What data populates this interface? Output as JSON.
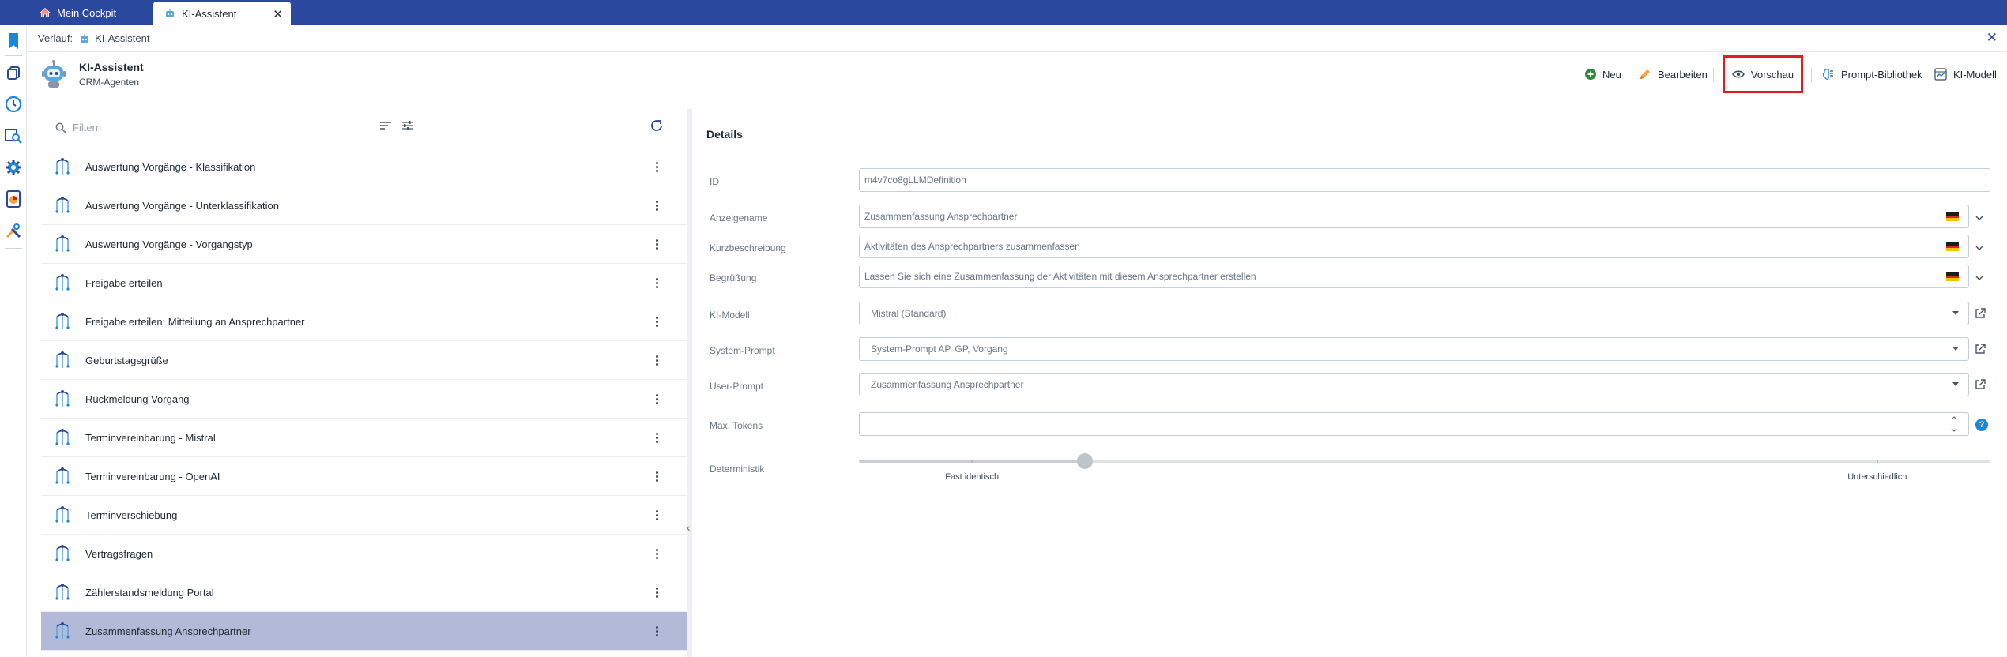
{
  "tabs": [
    {
      "label": "Mein Cockpit",
      "icon": "home-icon"
    },
    {
      "label": "KI-Assistent",
      "icon": "robot-icon"
    }
  ],
  "rail_icons": [
    "bookmark-icon",
    "copy-icon",
    "history-icon",
    "search-list-icon",
    "settings-gear-icon",
    "report-icon",
    "tools-icon"
  ],
  "breadcrumb": {
    "label": "Verlauf:",
    "item": "KI-Assistent"
  },
  "header": {
    "title": "KI-Assistent",
    "subtitle": "CRM-Agenten"
  },
  "toolbar": {
    "neu": "Neu",
    "bearbeiten": "Bearbeiten",
    "vorschau": "Vorschau",
    "prompt_bibliothek": "Prompt-Bibliothek",
    "ki_modell": "KI-Modell"
  },
  "filter": {
    "placeholder": "Filtern"
  },
  "agents": [
    {
      "label": "Auswertung Vorgänge - Klassifikation"
    },
    {
      "label": "Auswertung Vorgänge - Unterklassifikation"
    },
    {
      "label": "Auswertung Vorgänge - Vorgangstyp"
    },
    {
      "label": "Freigabe erteilen"
    },
    {
      "label": "Freigabe erteilen: Mitteilung an Ansprechpartner"
    },
    {
      "label": "Geburtstagsgrüße"
    },
    {
      "label": "Rückmeldung Vorgang"
    },
    {
      "label": "Terminvereinbarung - Mistral"
    },
    {
      "label": "Terminvereinbarung - OpenAI"
    },
    {
      "label": "Terminverschiebung"
    },
    {
      "label": "Vertragsfragen"
    },
    {
      "label": "Zählerstandsmeldung Portal"
    },
    {
      "label": "Zusammenfassung Ansprechpartner",
      "selected": true
    }
  ],
  "details": {
    "title": "Details",
    "fields": {
      "id": {
        "label": "ID",
        "value": "m4v7co8gLLMDefinition"
      },
      "anzeigename": {
        "label": "Anzeigename",
        "value": "Zusammenfassung Ansprechpartner"
      },
      "kurzbeschreibung": {
        "label": "Kurzbeschreibung",
        "value": "Aktivitäten des Ansprechpartners zusammenfassen"
      },
      "begruessung": {
        "label": "Begrüßung",
        "value": "Lassen Sie sich eine Zusammenfassung der Aktivitäten mit diesem Ansprechpartner erstellen"
      },
      "ki_modell": {
        "label": "KI-Modell",
        "value": "Mistral (Standard)"
      },
      "system_prompt": {
        "label": "System-Prompt",
        "value": "System-Prompt AP, GP, Vorgang"
      },
      "user_prompt": {
        "label": "User-Prompt",
        "value": "Zusammenfassung Ansprechpartner"
      },
      "max_tokens": {
        "label": "Max. Tokens",
        "value": ""
      },
      "deterministik": {
        "label": "Deterministik",
        "level_fraction": 0.2,
        "marks": [
          {
            "label": "Fast identisch",
            "fraction": 0.1
          },
          {
            "label": "Unterschiedlich",
            "fraction": 0.9
          }
        ]
      }
    }
  },
  "colors": {
    "tabbar": "#2b489f",
    "selected_row": "#b2bad8",
    "highlight_border": "#e21b23",
    "help": "#1d86d6",
    "flag": [
      "#1c1c1c",
      "#d62828",
      "#f4c20d"
    ]
  }
}
